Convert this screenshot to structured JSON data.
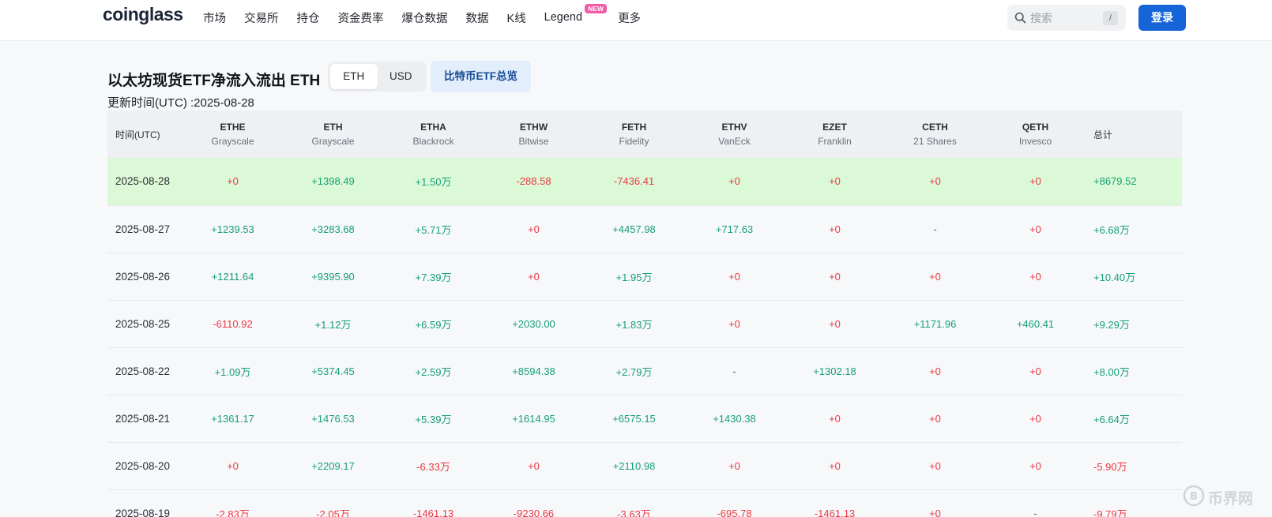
{
  "header": {
    "logo": "coinglass",
    "nav": [
      {
        "label": "市场"
      },
      {
        "label": "交易所"
      },
      {
        "label": "持仓"
      },
      {
        "label": "资金费率"
      },
      {
        "label": "爆仓数据"
      },
      {
        "label": "数据"
      },
      {
        "label": "K线"
      },
      {
        "label": "Legend",
        "badge": "NEW"
      },
      {
        "label": "更多"
      }
    ],
    "search": {
      "placeholder": "搜索",
      "shortcut": "/",
      "icon": "search-icon"
    },
    "login_label": "登录"
  },
  "title": "以太坊现货ETF净流入流出 ETH",
  "unit_toggle": {
    "options": [
      "ETH",
      "USD"
    ],
    "active": "ETH"
  },
  "btc_overview_label": "比特币ETF总览",
  "update_time": "更新时间(UTC) :2025-08-28",
  "table": {
    "time_header": "时间(UTC)",
    "total_header": "总计",
    "columns": [
      {
        "code": "ETHE",
        "issuer": "Grayscale"
      },
      {
        "code": "ETH",
        "issuer": "Grayscale"
      },
      {
        "code": "ETHA",
        "issuer": "Blackrock"
      },
      {
        "code": "ETHW",
        "issuer": "Bitwise"
      },
      {
        "code": "FETH",
        "issuer": "Fidelity"
      },
      {
        "code": "ETHV",
        "issuer": "VanEck"
      },
      {
        "code": "EZET",
        "issuer": "Franklin"
      },
      {
        "code": "CETH",
        "issuer": "21 Shares"
      },
      {
        "code": "QETH",
        "issuer": "Invesco"
      }
    ],
    "rows": [
      {
        "date": "2025-08-28",
        "highlight": true,
        "values": [
          "+0",
          "+1398.49",
          "+1.50万",
          "-288.58",
          "-7436.41",
          "+0",
          "+0",
          "+0",
          "+0"
        ],
        "total": "+8679.52"
      },
      {
        "date": "2025-08-27",
        "values": [
          "+1239.53",
          "+3283.68",
          "+5.71万",
          "+0",
          "+4457.98",
          "+717.63",
          "+0",
          "-",
          "+0"
        ],
        "total": "+6.68万"
      },
      {
        "date": "2025-08-26",
        "values": [
          "+1211.64",
          "+9395.90",
          "+7.39万",
          "+0",
          "+1.95万",
          "+0",
          "+0",
          "+0",
          "+0"
        ],
        "total": "+10.40万"
      },
      {
        "date": "2025-08-25",
        "values": [
          "-6110.92",
          "+1.12万",
          "+6.59万",
          "+2030.00",
          "+1.83万",
          "+0",
          "+0",
          "+1171.96",
          "+460.41"
        ],
        "total": "+9.29万"
      },
      {
        "date": "2025-08-22",
        "values": [
          "+1.09万",
          "+5374.45",
          "+2.59万",
          "+8594.38",
          "+2.79万",
          "-",
          "+1302.18",
          "+0",
          "+0"
        ],
        "total": "+8.00万"
      },
      {
        "date": "2025-08-21",
        "values": [
          "+1361.17",
          "+1476.53",
          "+5.39万",
          "+1614.95",
          "+6575.15",
          "+1430.38",
          "+0",
          "+0",
          "+0"
        ],
        "total": "+6.64万"
      },
      {
        "date": "2025-08-20",
        "values": [
          "+0",
          "+2209.17",
          "-6.33万",
          "+0",
          "+2110.98",
          "+0",
          "+0",
          "+0",
          "+0"
        ],
        "total": "-5.90万"
      },
      {
        "date": "2025-08-19",
        "values": [
          "-2.83万",
          "-2.05万",
          "-1461.13",
          "-9230.66",
          "-3.63万",
          "-695.78",
          "-1461.13",
          "+0",
          "-"
        ],
        "total": "-9.79万"
      }
    ]
  },
  "colors": {
    "positive": "#16a075",
    "negative": "#ea3943",
    "zero": "#ea3943",
    "accent": "#1565d8",
    "highlight_row": "#dcf9d7"
  },
  "watermark": {
    "text": "币界网"
  }
}
